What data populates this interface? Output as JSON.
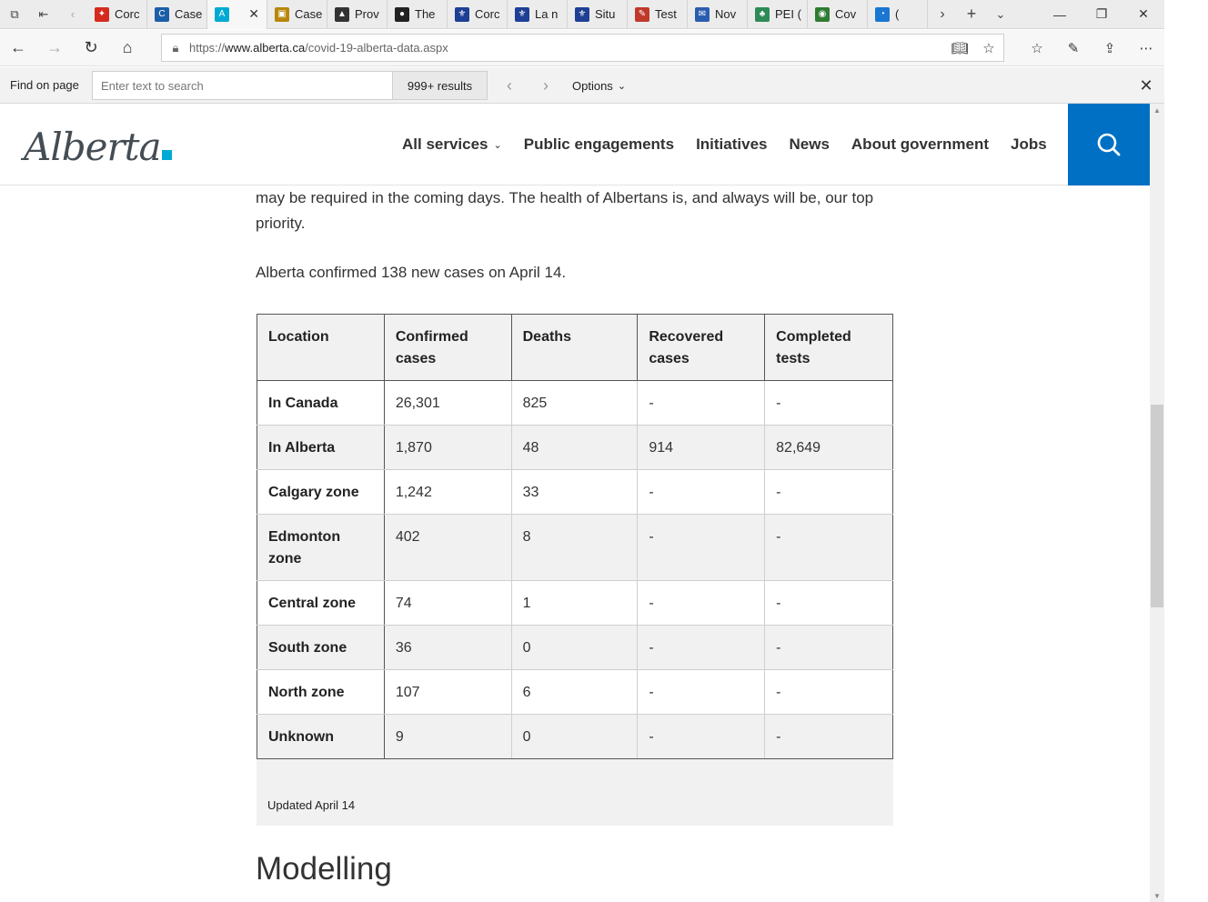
{
  "browser": {
    "tabs": [
      {
        "title": "Corc",
        "color": "#d52b1e",
        "glyph": "✦"
      },
      {
        "title": "Case",
        "color": "#1d5ea8",
        "glyph": "C"
      },
      {
        "title": "",
        "color": "#00aad2",
        "glyph": "A"
      },
      {
        "title": "Case",
        "color": "#b8860b",
        "glyph": "▣"
      },
      {
        "title": "Prov",
        "color": "#333333",
        "glyph": "▲"
      },
      {
        "title": "The",
        "color": "#222222",
        "glyph": "●"
      },
      {
        "title": "Corc",
        "color": "#1f3f95",
        "glyph": "⚜"
      },
      {
        "title": "La n",
        "color": "#1f3f95",
        "glyph": "⚜"
      },
      {
        "title": "Situ",
        "color": "#1f3f95",
        "glyph": "⚜"
      },
      {
        "title": "Test",
        "color": "#c0392b",
        "glyph": "✎"
      },
      {
        "title": "Nov",
        "color": "#2a5db0",
        "glyph": "✉"
      },
      {
        "title": "PEI (",
        "color": "#2e8b57",
        "glyph": "♣"
      },
      {
        "title": "Cov",
        "color": "#2e7d32",
        "glyph": "◉"
      },
      {
        "title": "(",
        "color": "#1976d2",
        "glyph": "◔"
      }
    ],
    "url_prefix": "https://",
    "url_host": "www.alberta.ca",
    "url_path": "/covid-19-alberta-data.aspx"
  },
  "findbar": {
    "label": "Find on page",
    "placeholder": "Enter text to search",
    "results": "999+ results",
    "options_label": "Options"
  },
  "site": {
    "logo_text": "Alberta",
    "nav": [
      "All services",
      "Public engagements",
      "Initiatives",
      "News",
      "About government",
      "Jobs"
    ]
  },
  "content": {
    "para_line1": "may be required in the coming days. The health of Albertans is, and always will be, our top",
    "para_line2": "priority.",
    "para2": "Alberta confirmed 138 new cases on April 14.",
    "table": {
      "headers": [
        "Location",
        "Confirmed cases",
        "Deaths",
        "Recovered cases",
        "Completed tests"
      ],
      "rows": [
        [
          "In Canada",
          "26,301",
          "825",
          "-",
          "-"
        ],
        [
          "In Alberta",
          "1,870",
          "48",
          "914",
          "82,649"
        ],
        [
          "Calgary zone",
          "1,242",
          "33",
          "-",
          "-"
        ],
        [
          "Edmonton zone",
          "402",
          "8",
          "-",
          "-"
        ],
        [
          "Central zone",
          "74",
          "1",
          "-",
          "-"
        ],
        [
          "South zone",
          "36",
          "0",
          "-",
          "-"
        ],
        [
          "North zone",
          "107",
          "6",
          "-",
          "-"
        ],
        [
          "Unknown",
          "9",
          "0",
          "-",
          "-"
        ]
      ]
    },
    "caption": "Updated April 14",
    "section_heading": "Modelling"
  }
}
